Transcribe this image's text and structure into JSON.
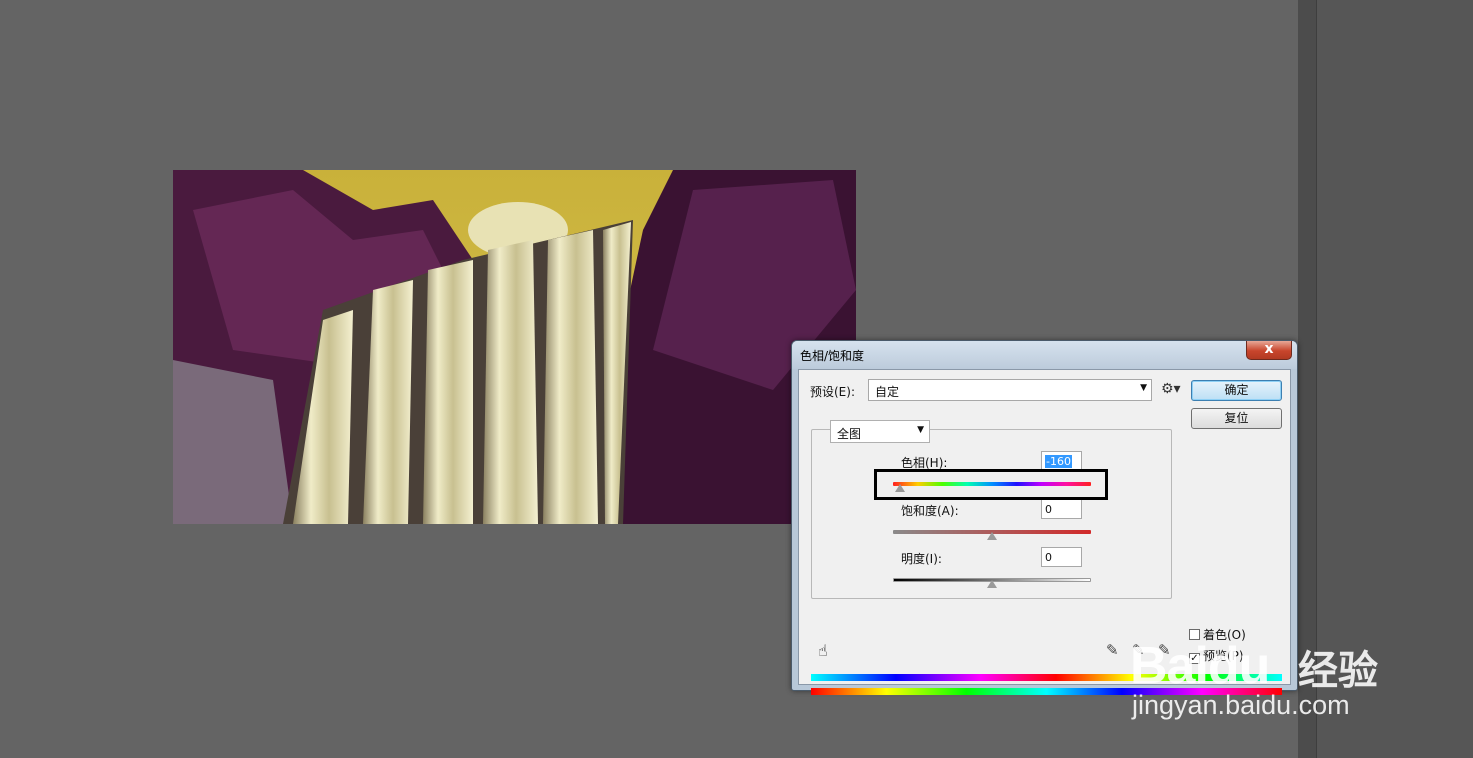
{
  "dialog": {
    "title": "色相/饱和度",
    "close_label": "x",
    "preset_label": "预设(E):",
    "preset_value": "自定",
    "ok_label": "确定",
    "reset_label": "复位",
    "channel_value": "全图",
    "hue": {
      "label": "色相(H):",
      "value": "-160",
      "level": -160
    },
    "saturation": {
      "label": "饱和度(A):",
      "value": "0",
      "level": 0
    },
    "lightness": {
      "label": "明度(I):",
      "value": "0",
      "level": 0
    },
    "colorize": {
      "label": "着色(O)",
      "checked": false
    },
    "preview": {
      "label": "预览(P)",
      "checked": true
    }
  },
  "watermark": {
    "brand": "Baidu",
    "cn": "经验",
    "url": "jingyan.baidu.com"
  },
  "colors": {
    "workspace": "#646464",
    "dialog_frame": "#b8c8d8",
    "ok_button": "#bde0f5"
  }
}
